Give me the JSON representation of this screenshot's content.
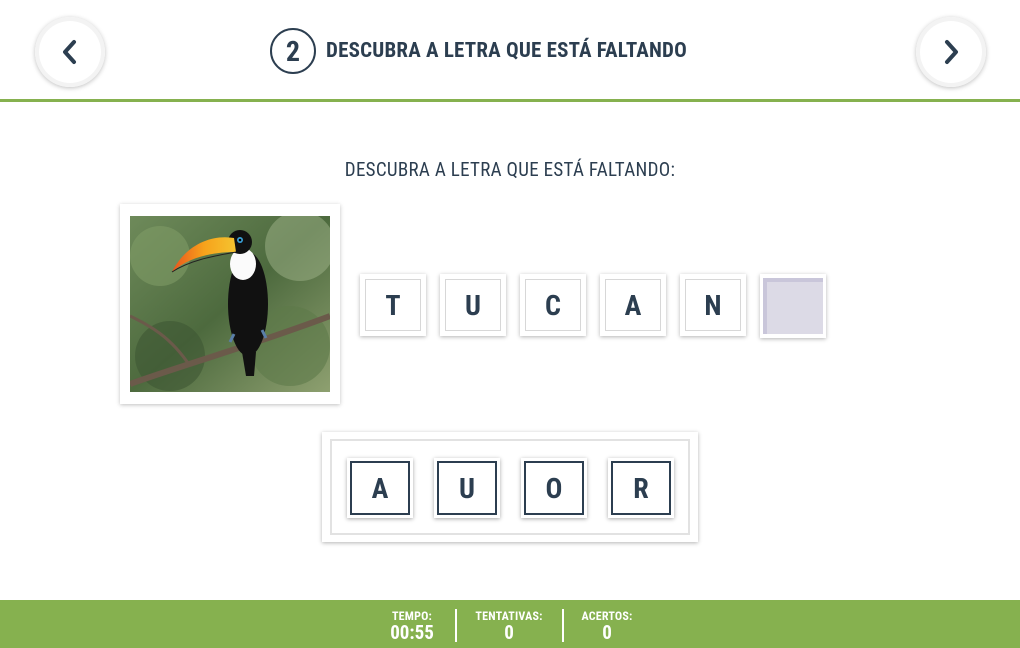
{
  "header": {
    "step_number": "2",
    "title": "DESCUBRA A LETRA QUE ESTÁ FALTANDO",
    "prev_icon": "chevron-left-icon",
    "next_icon": "chevron-right-icon"
  },
  "main": {
    "instruction": "DESCUBRA A LETRA QUE ESTÁ FALTANDO:",
    "image_subject": "toucan",
    "word_letters": [
      "T",
      "U",
      "C",
      "A",
      "N",
      ""
    ],
    "choices": [
      "A",
      "U",
      "O",
      "R"
    ]
  },
  "footer": {
    "tempo_label": "TEMPO:",
    "tempo_value": "00:55",
    "tentativas_label": "TENTATIVAS:",
    "tentativas_value": "0",
    "acertos_label": "ACERTOS:",
    "acertos_value": "0"
  },
  "colors": {
    "accent_green": "#86b14f",
    "text_dark": "#2c3e50",
    "blank_slot": "#dcdae6"
  }
}
